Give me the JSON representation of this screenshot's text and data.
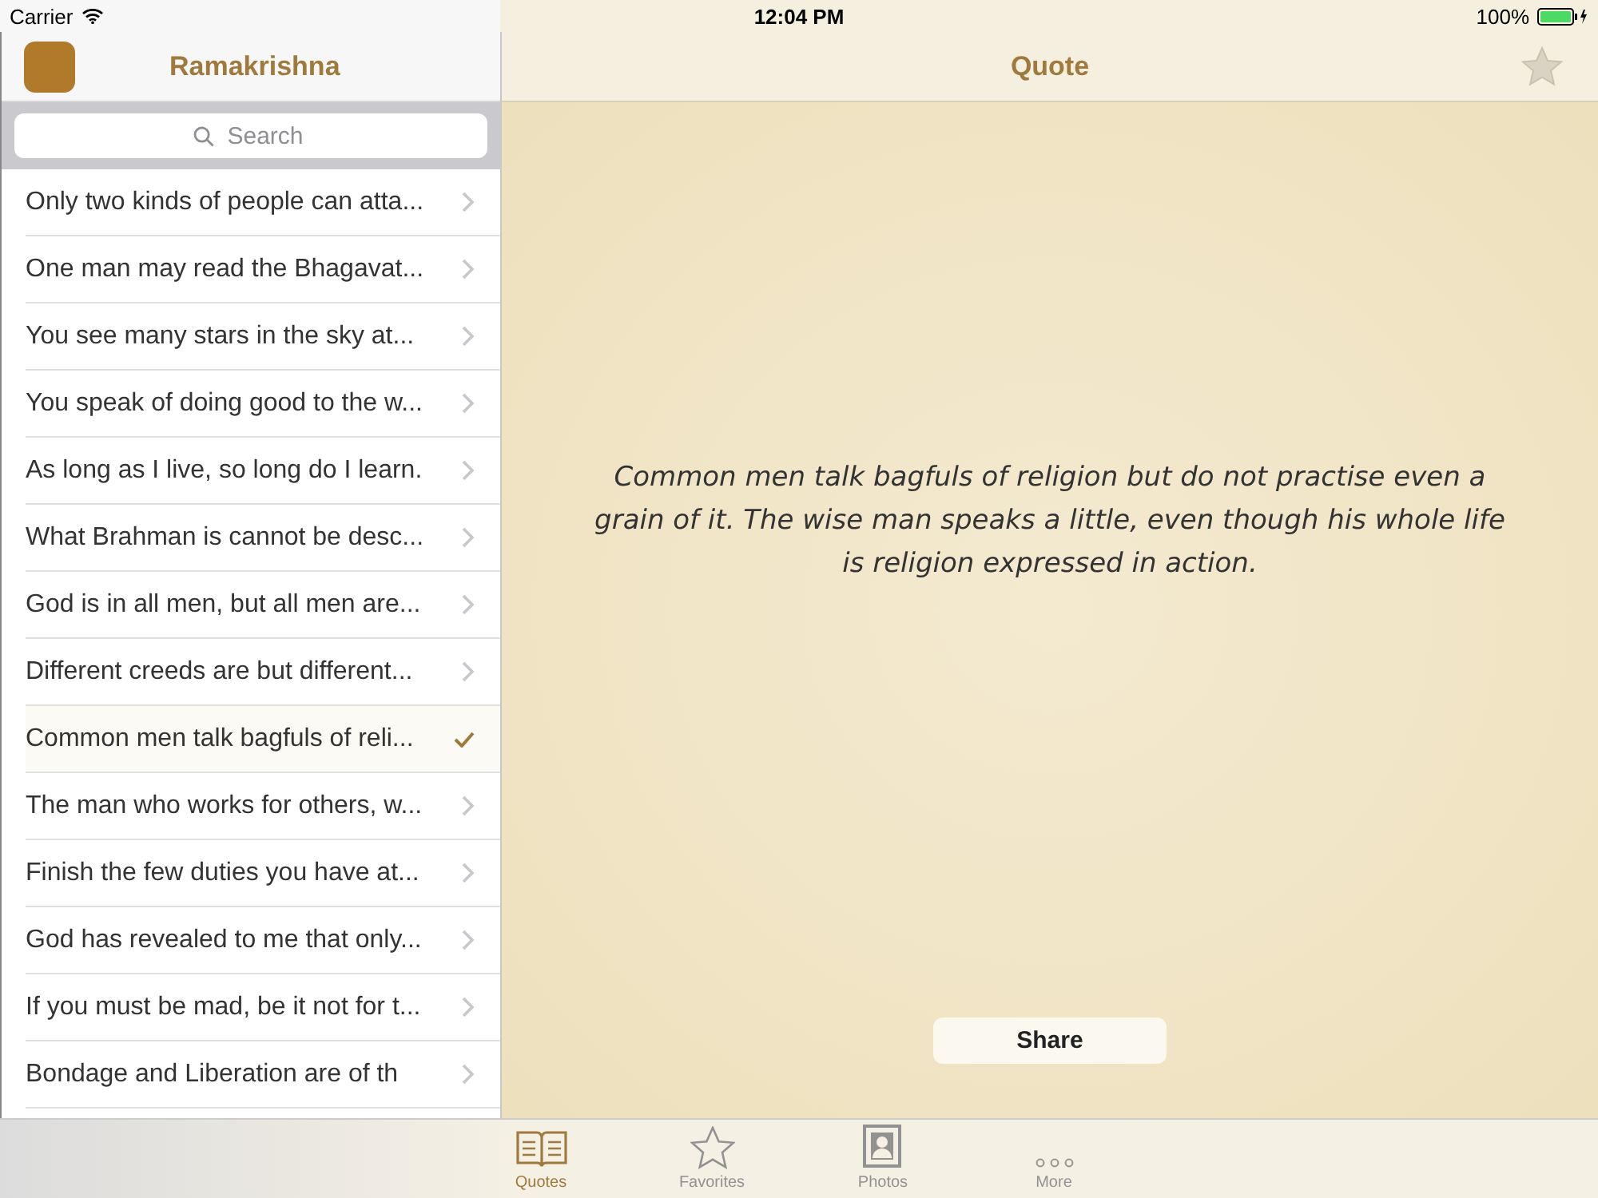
{
  "status_bar": {
    "carrier": "Carrier",
    "time": "12:04 PM",
    "battery": "100%"
  },
  "sidebar": {
    "title": "Ramakrishna",
    "search": {
      "placeholder": "Search"
    },
    "items": [
      {
        "text": "Only two kinds of people can atta...",
        "selected": false
      },
      {
        "text": "One man may read the Bhagavat...",
        "selected": false
      },
      {
        "text": "You see many stars in the sky at...",
        "selected": false
      },
      {
        "text": "You speak of doing good to the w...",
        "selected": false
      },
      {
        "text": "As long as I live, so long do I learn.",
        "selected": false
      },
      {
        "text": "What Brahman is cannot be desc...",
        "selected": false
      },
      {
        "text": "God is in all men, but all men are...",
        "selected": false
      },
      {
        "text": "Different creeds are but different...",
        "selected": false
      },
      {
        "text": "Common men talk bagfuls of reli...",
        "selected": true
      },
      {
        "text": "The man who works for others, w...",
        "selected": false
      },
      {
        "text": "Finish the few duties you have at...",
        "selected": false
      },
      {
        "text": "God has revealed to me that only...",
        "selected": false
      },
      {
        "text": "If you must be mad, be it not for t...",
        "selected": false
      },
      {
        "text": "Bondage and Liberation are of th",
        "selected": false
      }
    ]
  },
  "detail": {
    "title": "Quote",
    "favorite": false,
    "quote": "Common men talk bagfuls of religion but do not practise even a grain of it. The wise man speaks a little, even though his whole life is religion expressed in action.",
    "share_button": "Share"
  },
  "tab_bar": [
    {
      "kind": "book",
      "label": "Quotes",
      "selected": true
    },
    {
      "kind": "star",
      "label": "Favorites",
      "selected": false
    },
    {
      "kind": "photo",
      "label": "Photos",
      "selected": false
    },
    {
      "kind": "more",
      "label": "More",
      "selected": false
    }
  ]
}
